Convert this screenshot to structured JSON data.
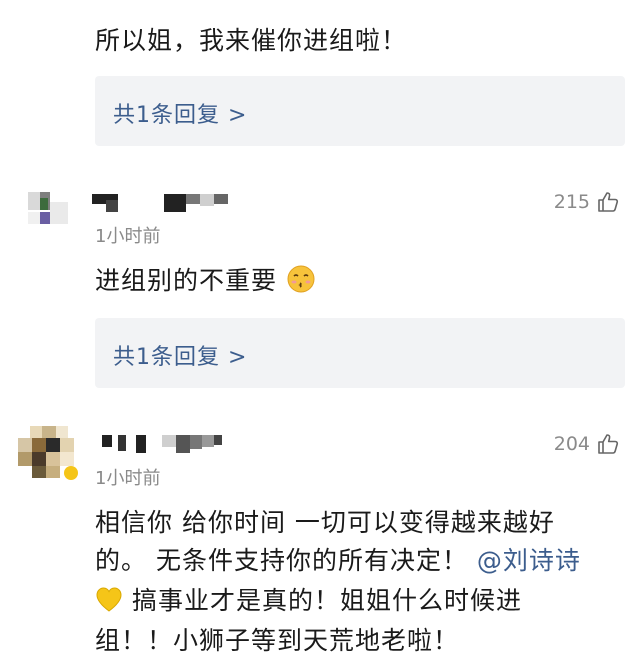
{
  "comments": [
    {
      "text": "所以姐，我来催你进组啦！",
      "replies_label": "共1条回复 >"
    },
    {
      "time": "1小时前",
      "likes": "215",
      "text": "进组别的不重要",
      "emoji": "kissing-face-emoji",
      "replies_label": "共1条回复 >"
    },
    {
      "time": "1小时前",
      "likes": "204",
      "text_line1": "相信你 给你时间 一切可以变得越来越好",
      "text_line2_pre": "的。 无条件支持你的所有决定！",
      "mention": "@刘诗诗",
      "text_line3": " 搞事业才是真的！姐姐什么时候进",
      "text_line4": "组！！小狮子等到天荒地老啦！",
      "emoji": "yellow-heart-emoji"
    }
  ],
  "colors": {
    "link": "#3c5d8d",
    "meta": "#8a8a8a",
    "reply_bg": "#f2f3f5",
    "text": "#1a1a1a"
  }
}
